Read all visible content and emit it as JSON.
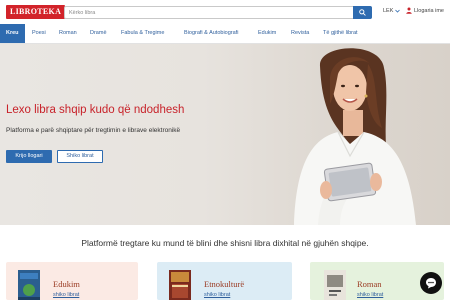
{
  "header": {
    "logo_text": "LIBROTEKA",
    "search_placeholder": "Kërko libra",
    "currency": "LEK",
    "login_label": "Llogaria ime"
  },
  "nav": {
    "items": [
      {
        "label": "Kreu"
      },
      {
        "label": "Poesi"
      },
      {
        "label": "Roman"
      },
      {
        "label": "Dramë"
      },
      {
        "label": "Fabula & Tregime"
      },
      {
        "label": "Biografi & Autobiografi"
      },
      {
        "label": "Edukim"
      },
      {
        "label": "Revista"
      },
      {
        "label": "Të gjithë librat"
      }
    ]
  },
  "hero": {
    "title": "Lexo libra shqip kudo që ndodhesh",
    "subtitle": "Platforma e parë shqiptare për tregtimin e librave elektronikë",
    "primary_button": "Krijo llogari",
    "secondary_button": "Shiko librat"
  },
  "tagline": "Platformë tregtare ku mund të blini dhe shisni libra dixhital në gjuhën shqipe.",
  "categories": [
    {
      "title": "Edukim",
      "link": "shiko librat"
    },
    {
      "title": "Etnokulturë",
      "link": "shiko librat"
    },
    {
      "title": "Roman",
      "link": "shiko librat"
    }
  ],
  "colors": {
    "brand_red": "#d2232a",
    "accent_blue": "#2e6bb0"
  }
}
